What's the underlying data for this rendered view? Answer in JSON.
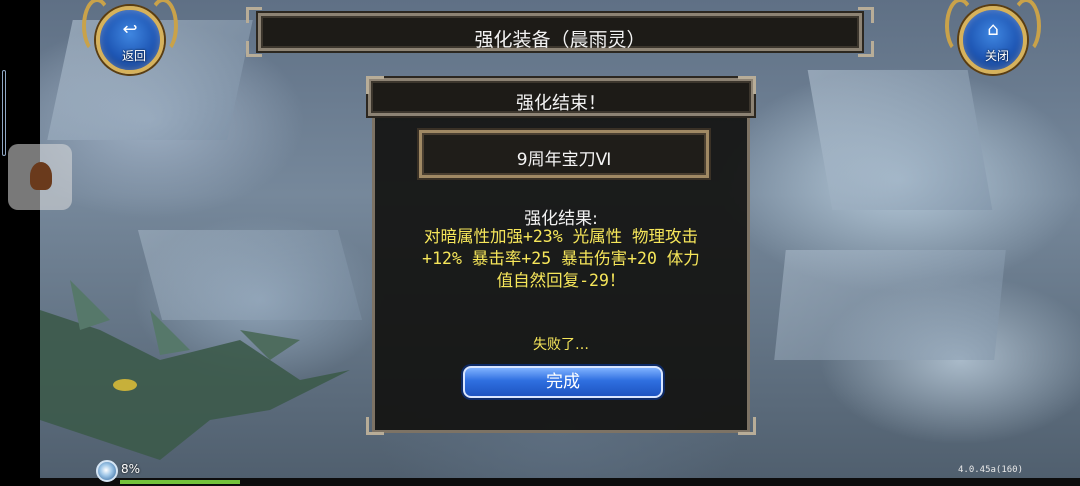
{
  "top_bar": {
    "title": "强化装备（晨雨灵）",
    "back_button": {
      "label": "返回",
      "icon": "return-arrow-icon"
    },
    "close_button": {
      "label": "关闭",
      "icon": "home-icon"
    }
  },
  "dialog": {
    "title": "强化结束！",
    "item_name": "9周年宝刀Ⅵ",
    "result_label": "强化结果:",
    "result_lines": [
      "对暗属性加强+23% 光属性 物理攻击",
      "+12% 暴击率+25 暴击伤害+20 体力",
      "值自然回复-29！"
    ],
    "status": "失败了…",
    "confirm_button": "完成"
  },
  "hud": {
    "gauge_percent": "8%",
    "gauge_fill": 0.08,
    "version": "4.0.45a(160)"
  },
  "colors": {
    "result_text": "#f6e65a",
    "button_blue": "#2f6fe0",
    "frame_gold": "#c9a24a"
  }
}
